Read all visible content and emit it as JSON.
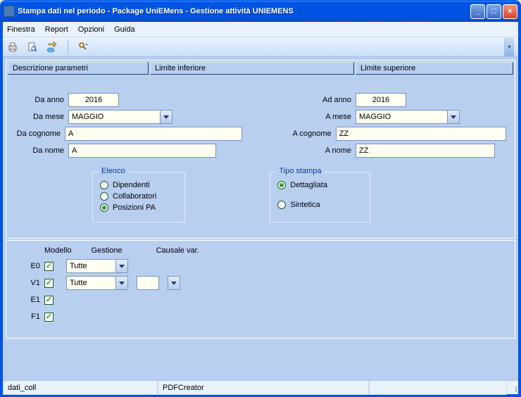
{
  "title": "Stampa dati nel periodo - Package UniEMens - Gestione attività UNIEMENS",
  "menu": {
    "finestra": "Finestra",
    "report": "Report",
    "opzioni": "Opzioni",
    "guida": "Guida"
  },
  "hdr": {
    "desc": "Descrizione parametri",
    "linf": "Limite inferiore",
    "lsup": "Limite superiore"
  },
  "labels": {
    "da_anno": "Da anno",
    "ad_anno": "Ad anno",
    "da_mese": "Da mese",
    "a_mese": "A mese",
    "da_cognome": "Da cognome",
    "a_cognome": "A cognome",
    "da_nome": "Da nome",
    "a_nome": "A nome",
    "modello": "Modello",
    "gestione": "Gestione",
    "causale": "Causale var."
  },
  "values": {
    "da_anno": "2016",
    "ad_anno": "2016",
    "da_mese": "MAGGIO",
    "a_mese": "MAGGIO",
    "da_cognome": "A",
    "a_cognome": "ZZ",
    "da_nome": "A",
    "a_nome": "ZZ"
  },
  "elenco": {
    "title": "Elenco",
    "opt1": "Dipendenti",
    "opt2": "Collaboratori",
    "opt3": "Posizioni PA",
    "selected": "opt3"
  },
  "tipostampa": {
    "title": "Tipo stampa",
    "opt1": "Dettagliata",
    "opt2": "Sintetica",
    "selected": "opt1"
  },
  "models": {
    "e0": "E0",
    "v1": "V1",
    "e1": "E1",
    "f1": "F1",
    "gest_e0": "Tutte",
    "gest_v1": "Tutte"
  },
  "status": {
    "left": "dati_coll",
    "mid": "PDFCreator"
  }
}
